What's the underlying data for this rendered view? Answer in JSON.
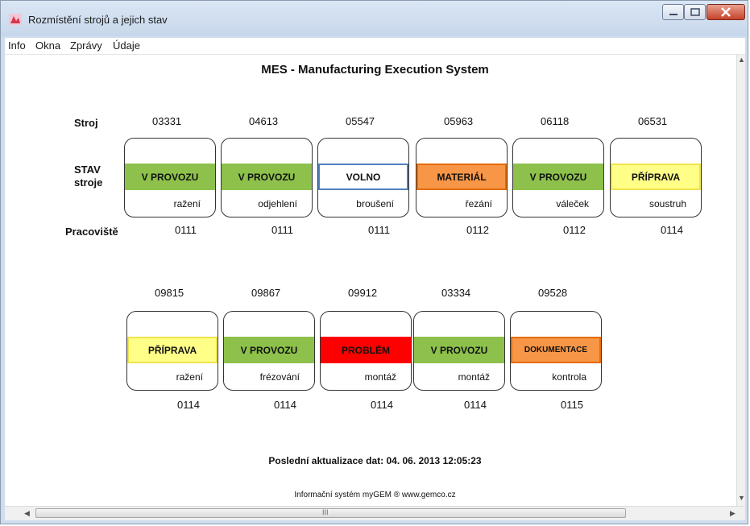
{
  "window": {
    "title": "Rozmístění strojů a jejich stav",
    "controls": {
      "minimize": "—",
      "maximize": "☐",
      "close": "X"
    }
  },
  "menu": [
    "Info",
    "Okna",
    "Zprávy",
    "Údaje"
  ],
  "page": {
    "title": "MES - Manufacturing Execution System",
    "labels": {
      "machine": "Stroj",
      "state_line1": "STAV",
      "state_line2": "stroje",
      "workplace": "Pracoviště"
    },
    "rows": [
      {
        "machines": [
          {
            "id": "03331",
            "status": "V PROVOZU",
            "status_color": "#8dc14b",
            "operation": "ražení",
            "workplace": "0111"
          },
          {
            "id": "04613",
            "status": "V PROVOZU",
            "status_color": "#8dc14b",
            "operation": "odjehlení",
            "workplace": "0111"
          },
          {
            "id": "05547",
            "status": "VOLNO",
            "status_color": "#ffffff",
            "operation": "broušení",
            "workplace": "0111"
          },
          {
            "id": "05963",
            "status": "MATERIÁL",
            "status_color": "#f79646",
            "operation": "řezání",
            "workplace": "0112"
          },
          {
            "id": "06118",
            "status": "V PROVOZU",
            "status_color": "#8dc14b",
            "operation": "váleček",
            "workplace": "0112"
          },
          {
            "id": "06531",
            "status": "PŘÍPRAVA",
            "status_color": "#ffff88",
            "operation": "soustruh",
            "workplace": "0114"
          }
        ]
      },
      {
        "machines": [
          {
            "id": "09815",
            "status": "PŘÍPRAVA",
            "status_color": "#ffff88",
            "operation": "ražení",
            "workplace": "0114"
          },
          {
            "id": "09867",
            "status": "V PROVOZU",
            "status_color": "#8dc14b",
            "operation": "frézování",
            "workplace": "0114"
          },
          {
            "id": "09912",
            "status": "PROBLÉM",
            "status_color": "#ff0000",
            "operation": "montáž",
            "workplace": "0114"
          },
          {
            "id": "03334",
            "status": "V PROVOZU",
            "status_color": "#8dc14b",
            "operation": "montáž",
            "workplace": "0114"
          },
          {
            "id": "09528",
            "status": "DOKUMENTACE",
            "status_color": "#f79646",
            "operation": "kontrola",
            "workplace": "0115"
          }
        ]
      }
    ],
    "last_update": "Poslední aktualizace dat: 04. 06. 2013   12:05:23",
    "footer": "Informační systém myGEM ®   www.gemco.cz"
  },
  "scrollbar": {
    "left_arrow": "◀",
    "right_arrow": "▶",
    "up_arrow": "▲",
    "down_arrow": "▼",
    "grip": "III"
  }
}
